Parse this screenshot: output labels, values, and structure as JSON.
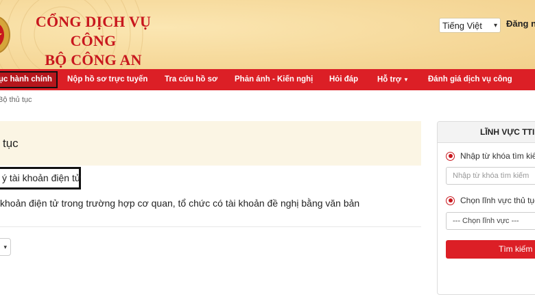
{
  "header": {
    "title_line1": "CỔNG DỊCH VỤ CÔNG",
    "title_line2": "BỘ CÔNG AN",
    "language": "Tiếng Việt",
    "login": "Đăng nh"
  },
  "nav": {
    "items": [
      {
        "label": "ục hành chính"
      },
      {
        "label": "Nộp hồ sơ trực tuyến"
      },
      {
        "label": "Tra cứu hồ sơ"
      },
      {
        "label": "Phản ánh - Kiến nghị"
      },
      {
        "label": "Hỏi đáp"
      },
      {
        "label": "Hỗ trợ"
      },
      {
        "label": "Đánh giá dịch vụ công"
      }
    ]
  },
  "breadcrumb": "Bộ thủ tục",
  "main": {
    "title": "tục",
    "highlight": "ý tài khoản điện tử",
    "description": "khoản điện tử trong trường hợp cơ quan, tổ chức có tài khoản đề nghị bằng văn bản"
  },
  "side": {
    "heading": "LĨNH VỰC TTI",
    "radio1_label": "Nhập từ khóa tìm kiế",
    "search_placeholder": "Nhập từ khóa tìm kiếm",
    "radio2_label": "Chọn lĩnh vực thủ tục",
    "select_value": "--- Chọn lĩnh vực ---",
    "search_button": "Tìm kiếm"
  },
  "colors": {
    "brand_red": "#dc1f26",
    "title_red": "#c8171e",
    "header_bg": "#f7dca0",
    "panel_bg": "#fbf5e4"
  }
}
